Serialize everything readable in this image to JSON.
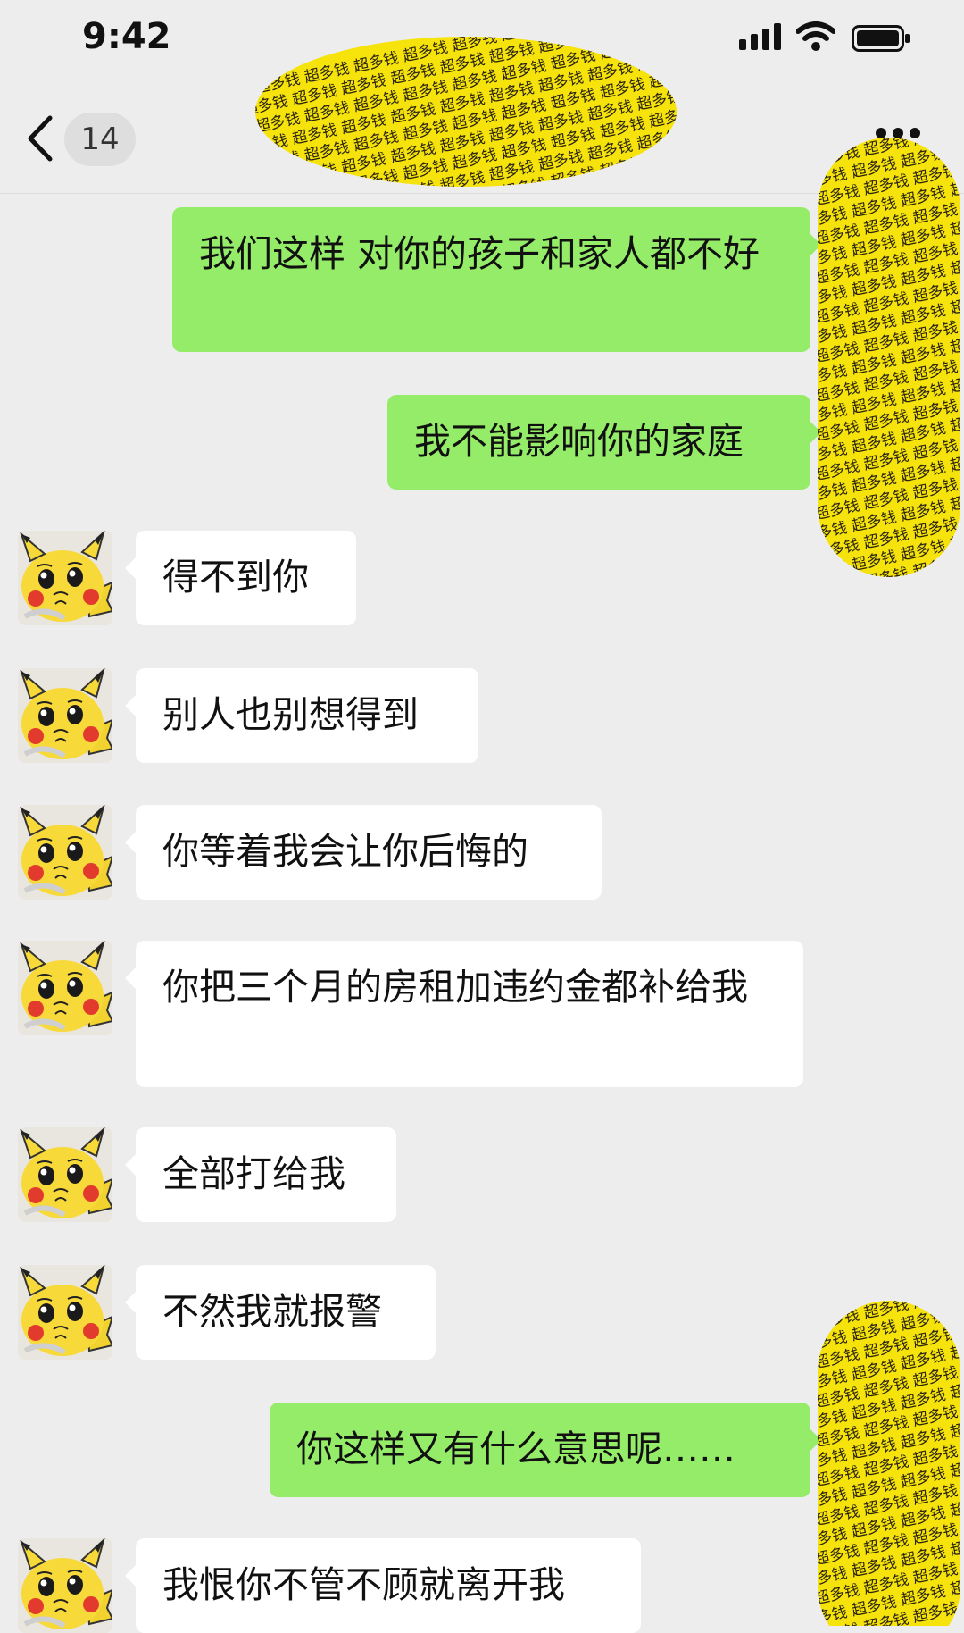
{
  "status_bar": {
    "time": "9:42",
    "battery": "full"
  },
  "header": {
    "unread_count": "14"
  },
  "censor_text": "超多钱",
  "messages": [
    {
      "side": "sent",
      "text": "我们这样 对你的孩子和家人都不好"
    },
    {
      "side": "sent",
      "text": "我不能影响你的家庭"
    },
    {
      "side": "received",
      "text": "得不到你"
    },
    {
      "side": "received",
      "text": "别人也别想得到"
    },
    {
      "side": "received",
      "text": "你等着我会让你后悔的"
    },
    {
      "side": "received",
      "text": "你把三个月的房租加违约金都补给我"
    },
    {
      "side": "received",
      "text": "全部打给我"
    },
    {
      "side": "received",
      "text": "不然我就报警"
    },
    {
      "side": "sent",
      "text": "你这样又有什么意思呢……"
    },
    {
      "side": "received",
      "text": "我恨你不管不顾就离开我"
    }
  ],
  "colors": {
    "sent_bubble": "#95ec69",
    "received_bubble": "#ffffff",
    "background": "#ededed",
    "censor_yellow": "#f6e30c"
  }
}
